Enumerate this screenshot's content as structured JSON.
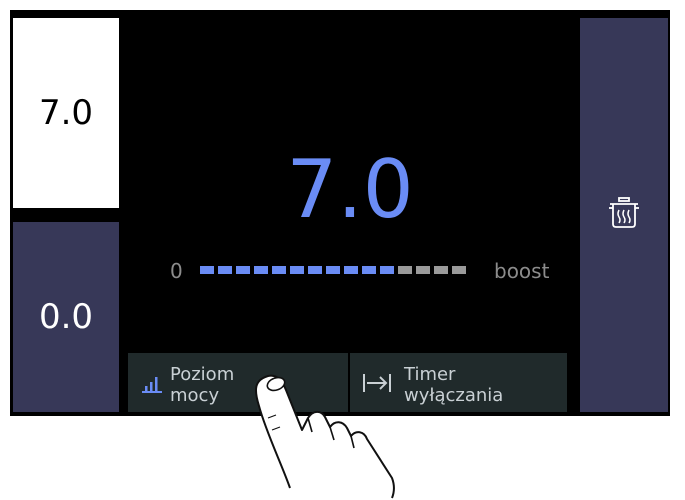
{
  "left_panel": {
    "zone_top_value": "7.0",
    "zone_bottom_value": "0.0"
  },
  "main": {
    "power_level": "7.0",
    "scale_min": "0",
    "scale_max": "boost",
    "bar": {
      "segments_total": 15,
      "segments_active": 11
    }
  },
  "buttons": {
    "power_level_label": "Poziom\nmocy",
    "timer_label": "Timer\nwyłączania"
  },
  "right_panel": {
    "icon": "pot-icon"
  },
  "icons": [
    "bars-icon",
    "arrow-to-line-icon",
    "pot-icon",
    "hand-pointer-icon"
  ],
  "colors": {
    "accent": "#6a8cf5",
    "inactive_segment": "#9a9a9a",
    "zone_panel": "#373858",
    "button_bg": "#202a2b",
    "screen_bg": "#000000"
  }
}
